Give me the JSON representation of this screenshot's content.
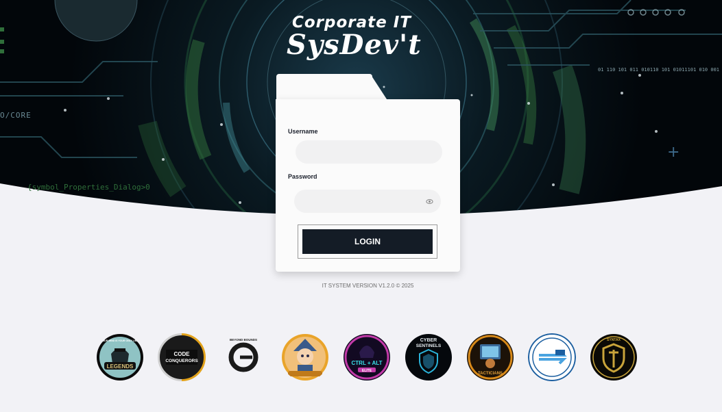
{
  "brand": {
    "subtitle": "Corporate IT",
    "title": "SysDev't"
  },
  "background_text": {
    "core": "O/CORE",
    "dialog": "{symbol_Properties_Dialog>0",
    "binary": "01 110 101 011 010110 101 01011101 010 001"
  },
  "login": {
    "username_label": "Username",
    "username_value": "",
    "password_label": "Password",
    "password_value": "",
    "button_label": "LOGIN"
  },
  "footer": {
    "version": "IT SYSTEM VERSION V1.2.0 © 2025"
  },
  "badges": {
    "legends": {
      "name": "LEGENDS",
      "motto": "YOUR MIND IS YOUR ONLY LIMIT"
    },
    "code_conquerors": {
      "line1": "CODE",
      "line2": "CONQUERORS"
    },
    "beyond_bounds": {
      "ring": "BEYOND BOUNDS"
    },
    "mascot": {},
    "ctrl_alt": {
      "line1": "CTRL + ALT",
      "line2": "ELITE"
    },
    "cyber_sentinels": {
      "line1": "CYBER",
      "line2": "SENTINELS"
    },
    "tacticians": {
      "label": "TACTICIANS"
    },
    "cloud_team": {},
    "syntax": {
      "ring": "SYNTAX"
    }
  },
  "colors": {
    "page_bg": "#f2f2f6",
    "hero_bg": "#050b10",
    "hero_green": "#2f6e3a",
    "card_bg": "#fbfbfb",
    "button_bg": "#141c26",
    "accent_blue": "#2a4d6e"
  },
  "icons": {
    "eye": "eye-icon",
    "plus": "plus-icon"
  }
}
